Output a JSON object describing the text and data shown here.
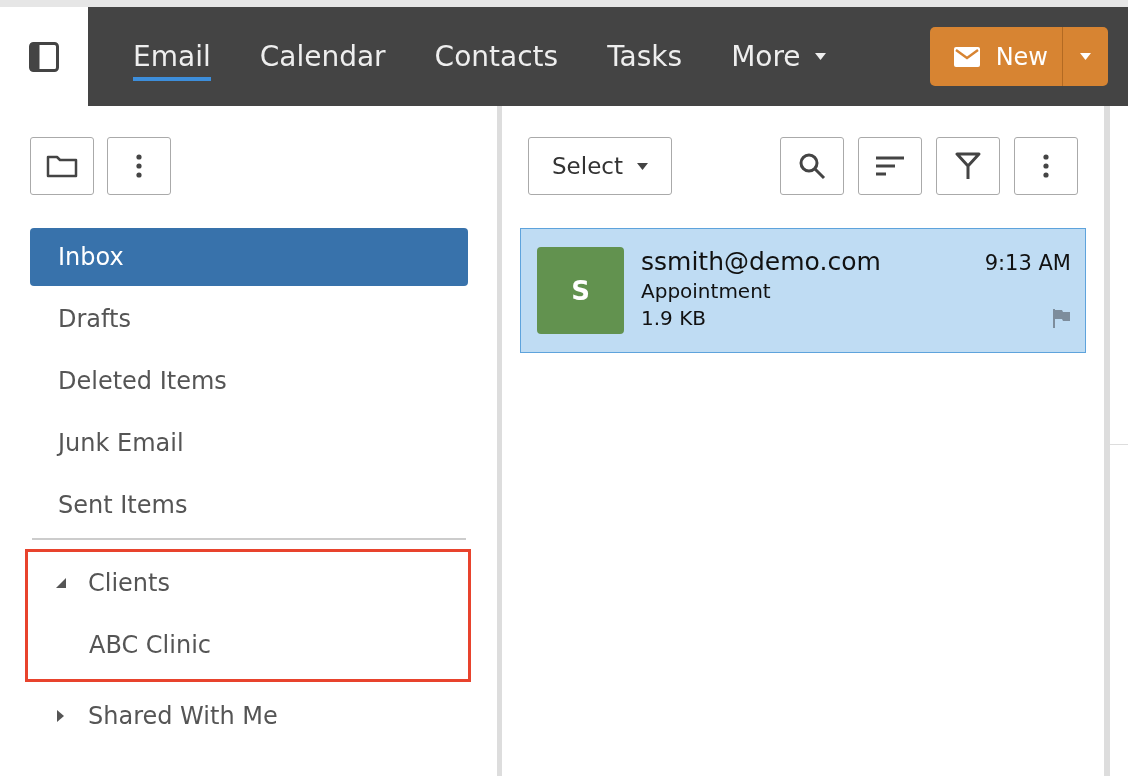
{
  "nav": {
    "tabs": [
      {
        "label": "Email",
        "selected": true,
        "dropdown": false
      },
      {
        "label": "Calendar",
        "selected": false,
        "dropdown": false
      },
      {
        "label": "Contacts",
        "selected": false,
        "dropdown": false
      },
      {
        "label": "Tasks",
        "selected": false,
        "dropdown": false
      },
      {
        "label": "More",
        "selected": false,
        "dropdown": true
      }
    ],
    "new_button": {
      "label": "New"
    }
  },
  "folders": {
    "items": [
      {
        "label": "Inbox",
        "selected": true
      },
      {
        "label": "Drafts",
        "selected": false
      },
      {
        "label": "Deleted Items",
        "selected": false
      },
      {
        "label": "Junk Email",
        "selected": false
      },
      {
        "label": "Sent Items",
        "selected": false
      }
    ],
    "tree": [
      {
        "label": "Clients",
        "expanded": true,
        "highlighted": true,
        "children": [
          {
            "label": "ABC Clinic"
          }
        ]
      },
      {
        "label": "Shared With Me",
        "expanded": false,
        "highlighted": false
      }
    ]
  },
  "messages": {
    "select_label": "Select",
    "items": [
      {
        "avatar": "S",
        "color": "#62924f",
        "sender": "ssmith@demo.com",
        "time": "9:13 AM",
        "subject": "Appointment",
        "size": "1.9 KB",
        "selected": true
      }
    ]
  }
}
